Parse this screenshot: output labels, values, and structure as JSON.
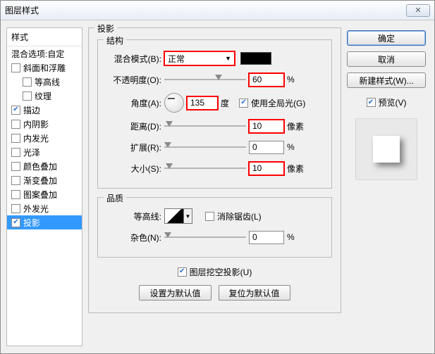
{
  "window": {
    "title": "图层样式",
    "close": "✕"
  },
  "styles": {
    "header": "样式",
    "blend": "混合选项:自定",
    "items": [
      {
        "label": "斜面和浮雕",
        "checked": false,
        "indent": false
      },
      {
        "label": "等高线",
        "checked": false,
        "indent": true
      },
      {
        "label": "纹理",
        "checked": false,
        "indent": true
      },
      {
        "label": "描边",
        "checked": true,
        "indent": false
      },
      {
        "label": "内阴影",
        "checked": false,
        "indent": false
      },
      {
        "label": "内发光",
        "checked": false,
        "indent": false
      },
      {
        "label": "光泽",
        "checked": false,
        "indent": false
      },
      {
        "label": "颜色叠加",
        "checked": false,
        "indent": false
      },
      {
        "label": "渐变叠加",
        "checked": false,
        "indent": false
      },
      {
        "label": "图案叠加",
        "checked": false,
        "indent": false
      },
      {
        "label": "外发光",
        "checked": false,
        "indent": false
      },
      {
        "label": "投影",
        "checked": true,
        "indent": false,
        "selected": true
      }
    ]
  },
  "main": {
    "title": "投影",
    "struct": {
      "title": "结构",
      "blend_label": "混合模式(B):",
      "blend_value": "正常",
      "opacity_label": "不透明度(O):",
      "opacity_value": "60",
      "opacity_unit": "%",
      "angle_label": "角度(A):",
      "angle_value": "135",
      "angle_unit": "度",
      "global_label": "使用全局光(G)",
      "global_checked": true,
      "distance_label": "距离(D):",
      "distance_value": "10",
      "distance_unit": "像素",
      "spread_label": "扩展(R):",
      "spread_value": "0",
      "spread_unit": "%",
      "size_label": "大小(S):",
      "size_value": "10",
      "size_unit": "像素"
    },
    "quality": {
      "title": "品质",
      "contour_label": "等高线:",
      "antialias_label": "消除锯齿(L)",
      "antialias_checked": false,
      "noise_label": "杂色(N):",
      "noise_value": "0",
      "noise_unit": "%"
    },
    "knockout": {
      "label": "图层挖空投影(U)",
      "checked": true
    },
    "btn_default": "设置为默认值",
    "btn_reset": "复位为默认值"
  },
  "right": {
    "ok": "确定",
    "cancel": "取消",
    "newstyle": "新建样式(W)...",
    "preview_label": "预览(V)",
    "preview_checked": true
  }
}
